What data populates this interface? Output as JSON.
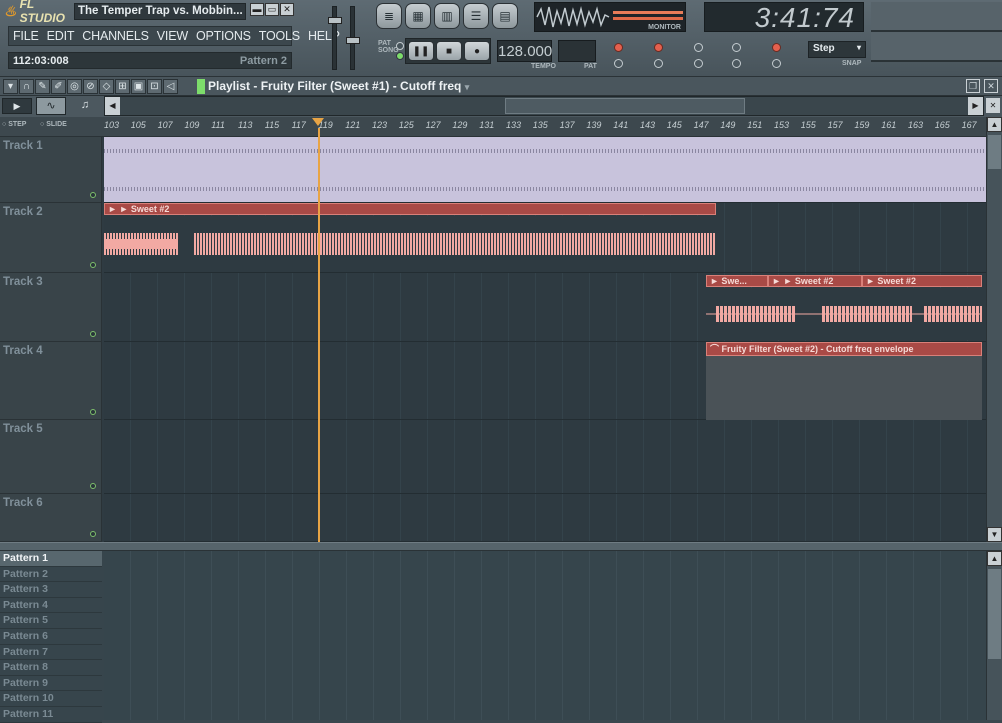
{
  "app": {
    "logo": "FL STUDIO",
    "project_title": "The Temper Trap vs. Mobbin...",
    "window_buttons": [
      "▬",
      "▭",
      "✕"
    ]
  },
  "menu": [
    "FILE",
    "EDIT",
    "CHANNELS",
    "VIEW",
    "OPTIONS",
    "TOOLS",
    "HELP"
  ],
  "hint": {
    "time": "112:03:008",
    "pattern": "Pattern 2"
  },
  "transport": {
    "pat_label": "PAT",
    "song_label": "SONG",
    "play": "▶",
    "stop": "■",
    "rec": "●",
    "tempo": "128.000",
    "tempo_label": "TEMPO",
    "pat_label2": "PAT"
  },
  "monitor": {
    "label": "MONITOR"
  },
  "clock": {
    "time": "3:41:74"
  },
  "snap": {
    "value": "Step",
    "label": "SNAP"
  },
  "playlist": {
    "title": "Playlist - Fruity Filter (Sweet #1) - Cutoff freq",
    "ruler": [
      "103",
      "105",
      "107",
      "109",
      "111",
      "113",
      "115",
      "117",
      "119",
      "121",
      "123",
      "125",
      "127",
      "129",
      "131",
      "133",
      "135",
      "137",
      "139",
      "141",
      "143",
      "145",
      "147",
      "149",
      "151",
      "153",
      "155",
      "157",
      "159",
      "161",
      "163",
      "165",
      "167"
    ],
    "step_label": "STEP",
    "slide_label": "SLIDE",
    "tracks": [
      "Track 1",
      "Track 2",
      "Track 3",
      "Track 4",
      "Track 5",
      "Track 6"
    ],
    "clips": {
      "track2": "Sweet #2",
      "track3_a": "Swe...",
      "track3_b": "Sweet #2",
      "track3_c": "Sweet #2",
      "automation": "Fruity Filter (Sweet #2) - Cutoff freq envelope"
    },
    "patterns": [
      "Pattern 1",
      "Pattern 2",
      "Pattern 3",
      "Pattern 4",
      "Pattern 5",
      "Pattern 6",
      "Pattern 7",
      "Pattern 8",
      "Pattern 9",
      "Pattern 10",
      "Pattern 11"
    ]
  },
  "colors": {
    "clip": "#a94a46",
    "wave": "#f2a9a3",
    "playhead": "#e8a445",
    "track1_wave": "#c8c3dc"
  }
}
